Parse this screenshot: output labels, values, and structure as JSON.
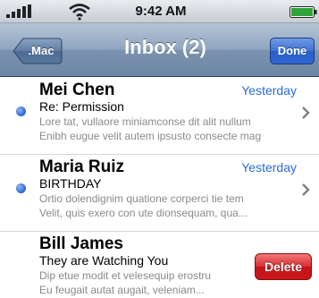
{
  "status_bar": {
    "time": "9:42 AM",
    "icons": [
      "signal-icon",
      "wifi-icon",
      "battery-icon"
    ]
  },
  "nav": {
    "back_label": ".Mac",
    "title": "Inbox (2)",
    "done_label": "Done"
  },
  "messages": [
    {
      "sender": "Mei Chen",
      "date": "Yesterday",
      "subject": "Re: Permission",
      "preview_line1": "Lore tat, vullaore miniamconse dit alit nullum",
      "preview_line2": "Enibh eugue velit autem ipsusto consecte mag",
      "unread": true
    },
    {
      "sender": "Maria Ruiz",
      "date": "Yesterday",
      "subject": "BIRTHDAY",
      "preview_line1": "Ortio dolendignim quatione corperci tie tem",
      "preview_line2": "Velit, quis exero con ute dionsequam, qua...",
      "unread": true
    },
    {
      "sender": "Bill James",
      "subject": "They are Watching You",
      "preview_line1": "Dip etue modit et velesequip erostru",
      "preview_line2": "Eu feugait autat augait, veleniam...",
      "unread": false,
      "action_label": "Delete"
    }
  ],
  "colors": {
    "accent_blue": "#2b6bd6",
    "unread_dot": "#2f68d8",
    "delete_red": "#c8181c",
    "nav_bar": "#7b93b0"
  }
}
